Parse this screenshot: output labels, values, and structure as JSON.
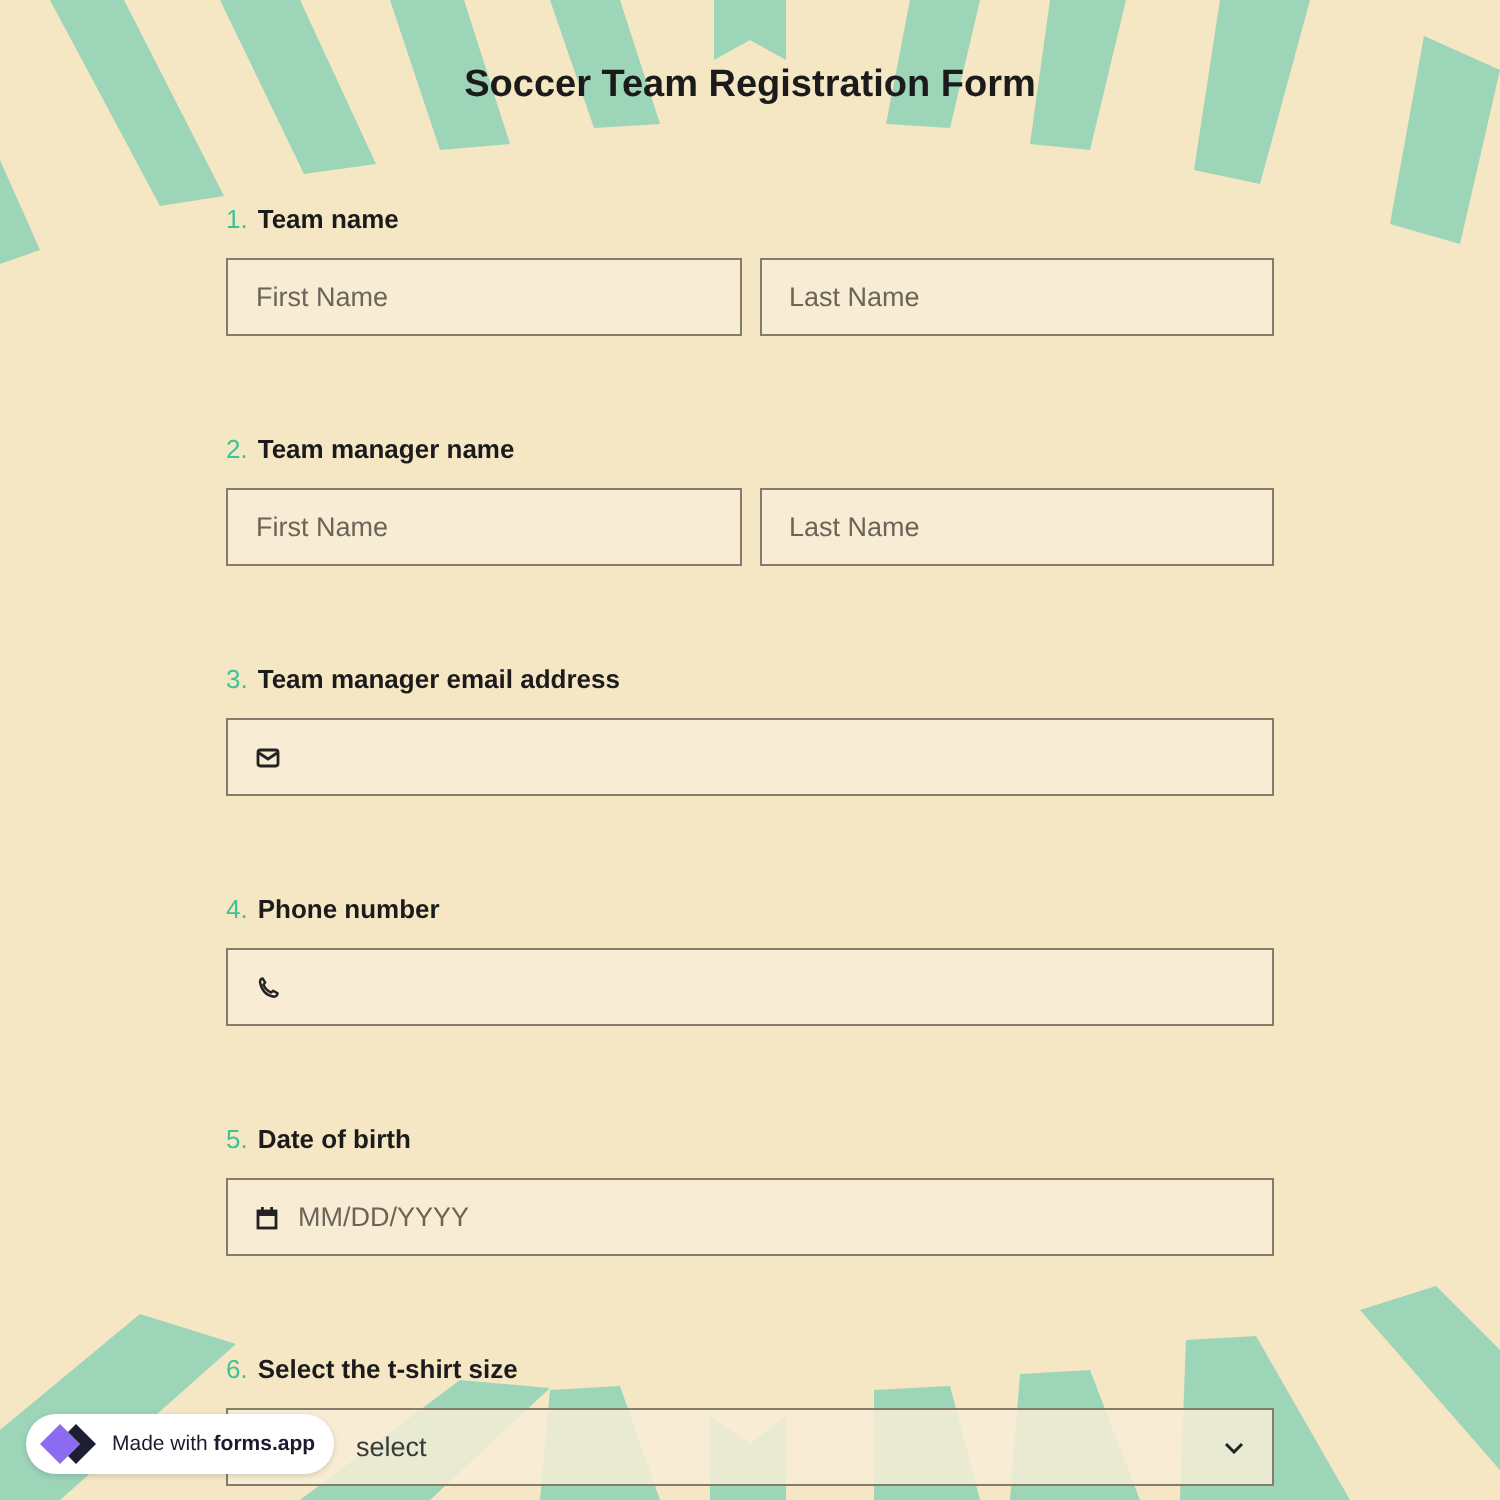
{
  "title": "Soccer Team Registration Form",
  "questions": [
    {
      "number": "1.",
      "label": "Team name",
      "kind": "name_pair",
      "fields": [
        {
          "placeholder": "First Name"
        },
        {
          "placeholder": "Last Name"
        }
      ]
    },
    {
      "number": "2.",
      "label": "Team manager name",
      "kind": "name_pair",
      "fields": [
        {
          "placeholder": "First Name"
        },
        {
          "placeholder": "Last Name"
        }
      ]
    },
    {
      "number": "3.",
      "label": "Team manager email address",
      "kind": "email"
    },
    {
      "number": "4.",
      "label": "Phone number",
      "kind": "phone"
    },
    {
      "number": "5.",
      "label": "Date of birth",
      "kind": "date",
      "placeholder": "MM/DD/YYYY"
    },
    {
      "number": "6.",
      "label": "Select the t-shirt size",
      "kind": "select",
      "placeholder": "select"
    }
  ],
  "badge": {
    "text": "Made with **forms.app**"
  }
}
